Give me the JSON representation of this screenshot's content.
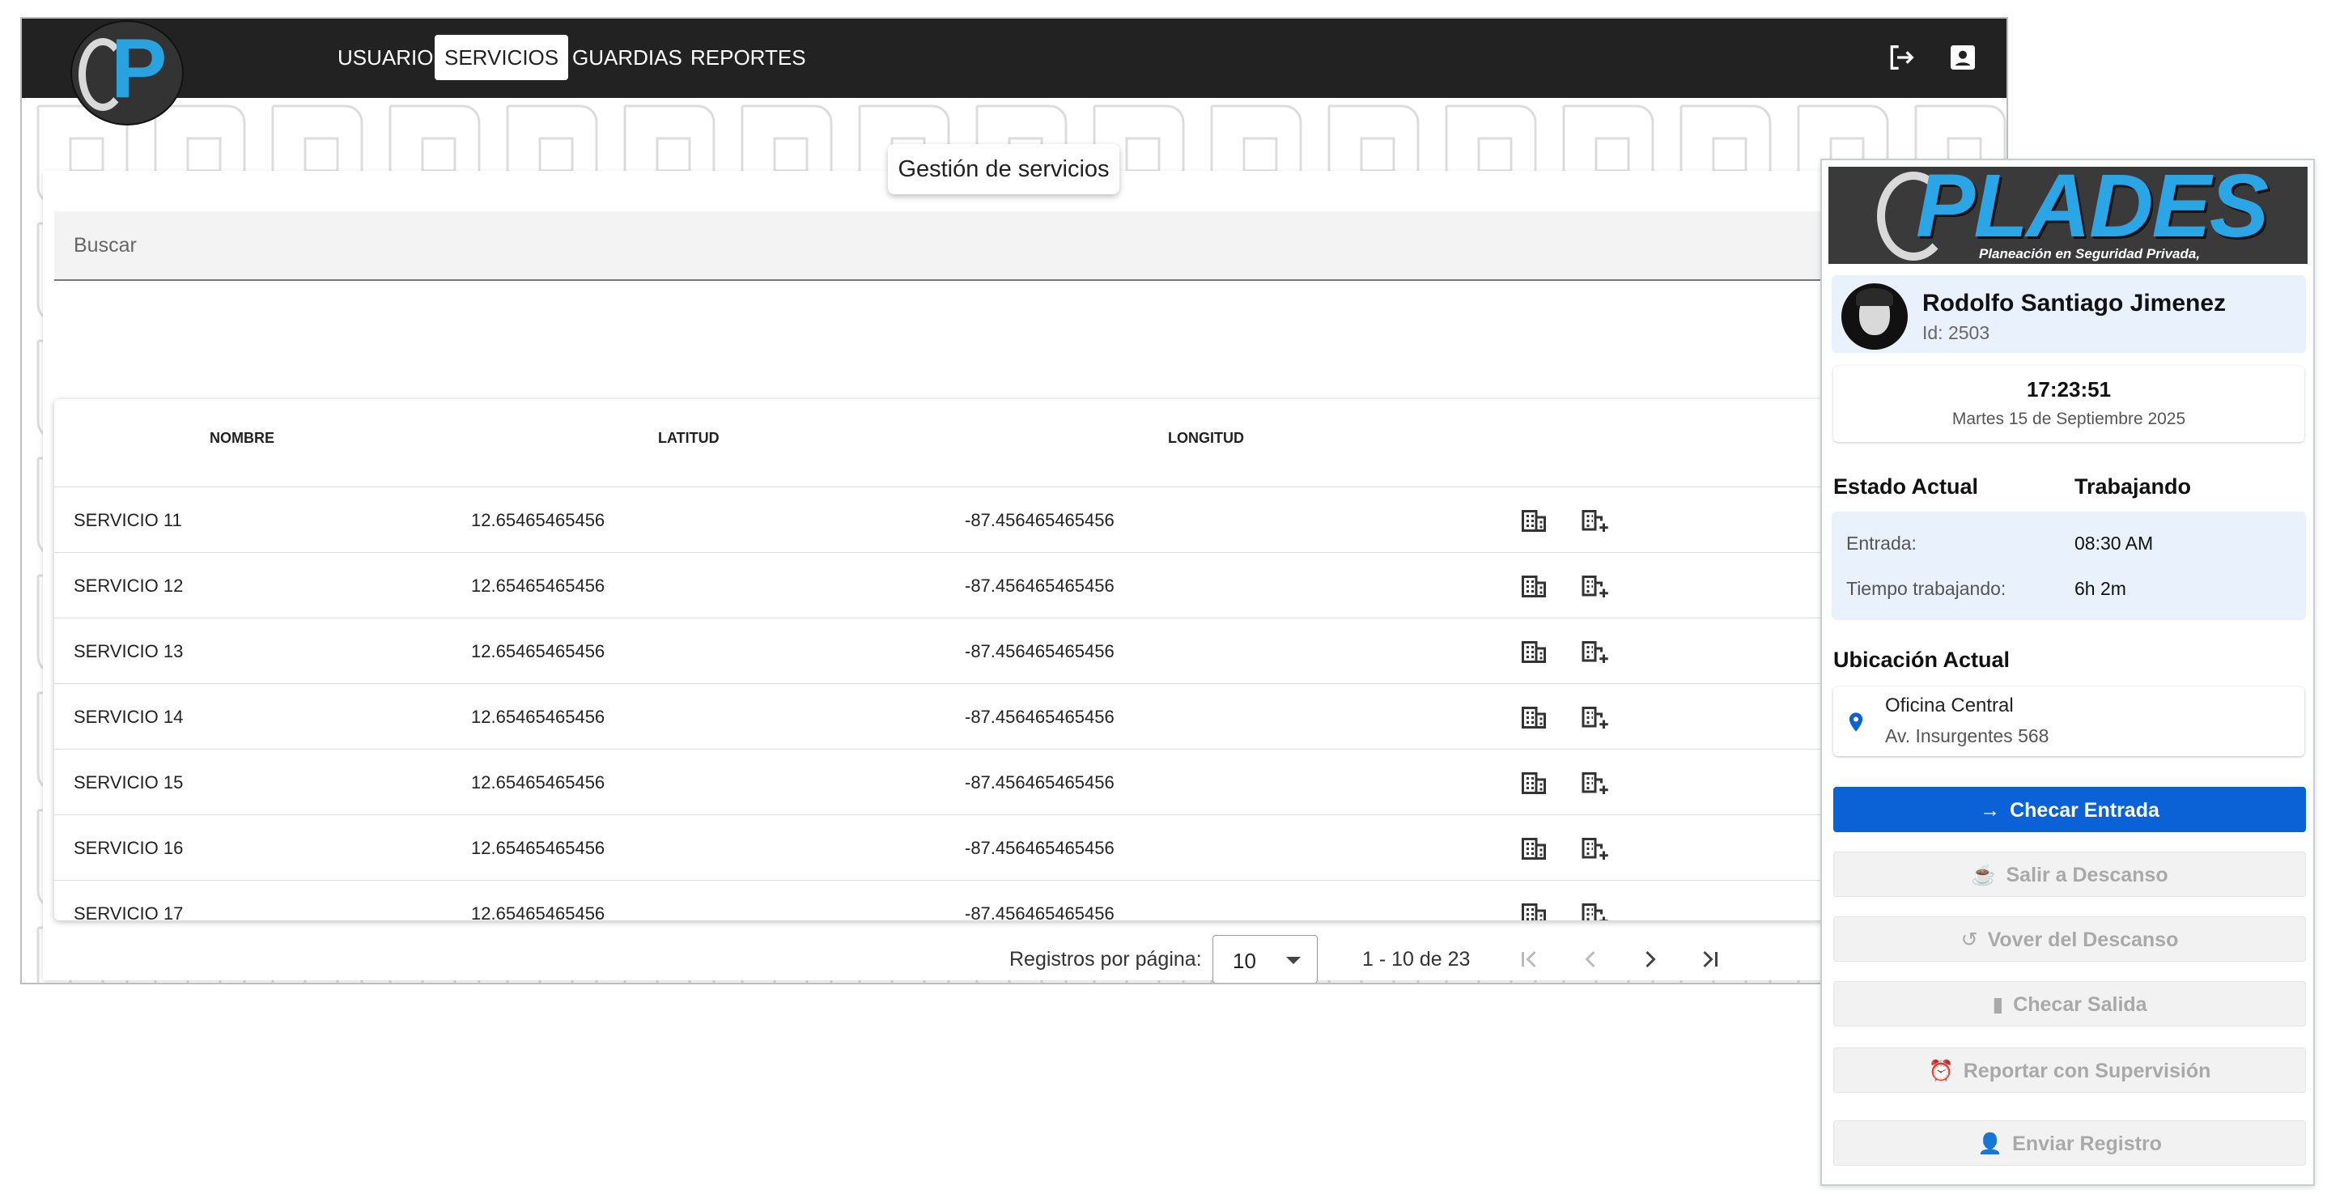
{
  "nav": {
    "links": [
      "USUARIOS",
      "SERVICIOS",
      "GUARDIAS",
      "REPORTES"
    ],
    "active": "SERVICIOS",
    "logo_letter": "P"
  },
  "page": {
    "title": "Gestión de servicios",
    "search_placeholder": "Buscar"
  },
  "table": {
    "columns": [
      "NOMBRE",
      "LATITUD",
      "LONGITUD"
    ],
    "rows": [
      [
        "SERVICIO 11",
        "12.65465465456",
        "-87.456465465456"
      ],
      [
        "SERVICIO 12",
        "12.65465465456",
        "-87.456465465456"
      ],
      [
        "SERVICIO 13",
        "12.65465465456",
        "-87.456465465456"
      ],
      [
        "SERVICIO 14",
        "12.65465465456",
        "-87.456465465456"
      ],
      [
        "SERVICIO 15",
        "12.65465465456",
        "-87.456465465456"
      ],
      [
        "SERVICIO 16",
        "12.65465465456",
        "-87.456465465456"
      ],
      [
        "SERVICIO 17",
        "12.65465465456",
        "-87.456465465456"
      ]
    ],
    "row_icons": [
      "building-icon",
      "add-building-icon"
    ]
  },
  "paginator": {
    "label": "Registros por página:",
    "page_size": "10",
    "range": "1 - 10 de 23"
  },
  "panel": {
    "brand_name": "PLADES",
    "brand_tagline": "Planeación en Seguridad Privada,",
    "user_name": "Rodolfo Santiago Jimenez",
    "user_id": "Id: 2503",
    "time": "17:23:51",
    "date": "Martes 15 de Septiembre 2025",
    "status_title": "Estado Actual",
    "status_value": "Trabajando",
    "entrada_label": "Entrada:",
    "entrada_value": "08:30 AM",
    "tiempo_label": "Tiempo trabajando:",
    "tiempo_value": "6h 2m",
    "location_title": "Ubicación Actual",
    "location_name": "Oficina Central",
    "location_address": "Av. Insurgentes 568",
    "actions": [
      {
        "label": "Checar Entrada",
        "icon": "arrow-right-icon",
        "enabled": true
      },
      {
        "label": "Salir a Descanso",
        "icon": "coffee-icon",
        "enabled": false
      },
      {
        "label": "Vover del Descanso",
        "icon": "undo-icon",
        "enabled": false
      },
      {
        "label": "Checar Salida",
        "icon": "door-exit-icon",
        "enabled": false
      },
      {
        "label": "Reportar con Supervisión",
        "icon": "alarm-icon",
        "enabled": false
      },
      {
        "label": "Enviar Registro",
        "icon": "user-add-icon",
        "enabled": false
      }
    ]
  },
  "colors": {
    "navbar": "#222222",
    "primary": "#0b62d6",
    "brand_blue": "#2aa5e6",
    "highlight": "#e8f1fc"
  }
}
